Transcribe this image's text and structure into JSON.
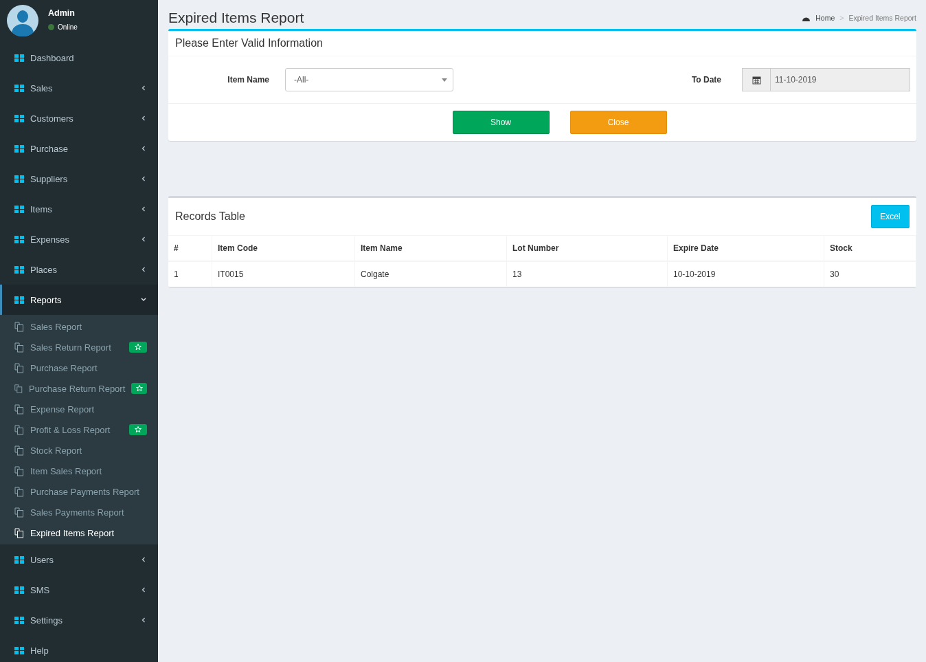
{
  "user": {
    "name": "Admin",
    "status": "Online"
  },
  "nav": [
    {
      "label": "Dashboard",
      "caret": false,
      "selected": false
    },
    {
      "label": "Sales",
      "caret": true,
      "selected": false
    },
    {
      "label": "Customers",
      "caret": true,
      "selected": false
    },
    {
      "label": "Purchase",
      "caret": true,
      "selected": false
    },
    {
      "label": "Suppliers",
      "caret": true,
      "selected": false
    },
    {
      "label": "Items",
      "caret": true,
      "selected": false
    },
    {
      "label": "Expenses",
      "caret": true,
      "selected": false
    },
    {
      "label": "Places",
      "caret": true,
      "selected": false
    },
    {
      "label": "Reports",
      "caret": true,
      "expanded": true,
      "selected": true,
      "children": [
        {
          "label": "Sales Report",
          "selected": false,
          "badge": false
        },
        {
          "label": "Sales Return Report",
          "selected": false,
          "badge": true
        },
        {
          "label": "Purchase Report",
          "selected": false,
          "badge": false
        },
        {
          "label": "Purchase Return Report",
          "selected": false,
          "badge": true
        },
        {
          "label": "Expense Report",
          "selected": false,
          "badge": false
        },
        {
          "label": "Profit & Loss Report",
          "selected": false,
          "badge": true
        },
        {
          "label": "Stock Report",
          "selected": false,
          "badge": false
        },
        {
          "label": "Item Sales Report",
          "selected": false,
          "badge": false
        },
        {
          "label": "Purchase Payments Report",
          "selected": false,
          "badge": false
        },
        {
          "label": "Sales Payments Report",
          "selected": false,
          "badge": false
        },
        {
          "label": "Expired Items Report",
          "selected": true,
          "badge": false
        }
      ]
    },
    {
      "label": "Users",
      "caret": true,
      "selected": false
    },
    {
      "label": "SMS",
      "caret": true,
      "selected": false
    },
    {
      "label": "Settings",
      "caret": true,
      "selected": false
    },
    {
      "label": "Help",
      "caret": false,
      "selected": false
    }
  ],
  "page_title": "Expired Items Report",
  "breadcrumb": [
    "Home",
    ">",
    "Expired Items Report"
  ],
  "form": {
    "title": "Please Enter Valid Information",
    "item_label": "Item Name",
    "item_value": "-All-",
    "date_label": "To Date",
    "date_value": "11-10-2019",
    "buttons": [
      "Show",
      "Close"
    ]
  },
  "records": {
    "title": "Records Table",
    "export": "Excel",
    "columns": [
      "#",
      "Item Code",
      "Item Name",
      "Lot Number",
      "Expire Date",
      "Stock"
    ],
    "rows": [
      [
        "1",
        "IT0015",
        "Colgate",
        "13",
        "10-10-2019",
        "30"
      ]
    ]
  }
}
